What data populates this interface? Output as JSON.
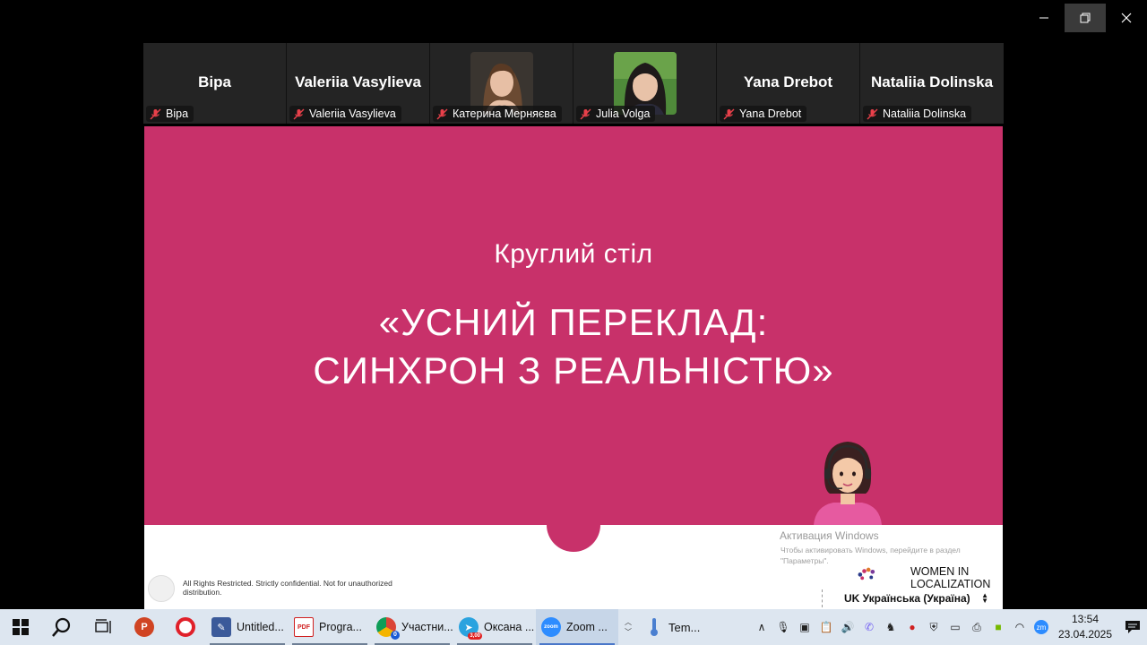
{
  "window": {
    "controls": [
      "minimize",
      "restore",
      "close"
    ]
  },
  "participants": [
    {
      "display": "Віра",
      "tag": "Віра",
      "type": "name"
    },
    {
      "display": "Valeriia Vasylieva",
      "tag": "Valeriia Vasylieva",
      "type": "name"
    },
    {
      "display": "",
      "tag": "Катерина Мерняєва",
      "type": "photo"
    },
    {
      "display": "",
      "tag": "Julia Volga",
      "type": "photo"
    },
    {
      "display": "Yana Drebot",
      "tag": "Yana Drebot",
      "type": "name"
    },
    {
      "display": "Nataliia Dolinska",
      "tag": "Nataliia Dolinska",
      "type": "name"
    }
  ],
  "slide": {
    "subtitle": "Круглий стіл",
    "title_line1": "«УСНИЙ ПЕРЕКЛАД:",
    "title_line2": "СИНХРОН З РЕАЛЬНІСТЮ»",
    "rights_text": "All Rights Restricted. Strictly confidential. Not for unauthorized distribution.",
    "logo_line1": "WOMEN IN",
    "logo_line2": "LOCALIZATION",
    "colors": {
      "accent": "#c8316a"
    }
  },
  "overlay": {
    "activation_title": "Активация Windows",
    "activation_text": "Чтобы активировать Windows, перейдите в раздел \"Параметры\".",
    "language": "UK Українська (Україна)"
  },
  "taskbar": {
    "apps": [
      {
        "label": "Untitled...",
        "icon": "paint-icon"
      },
      {
        "label": "Progra...",
        "icon": "pdf-icon"
      },
      {
        "label": "Участни...",
        "icon": "chrome-icon",
        "badge": "0"
      },
      {
        "label": "Оксана ...",
        "icon": "telegram-icon",
        "badge": "3,00"
      },
      {
        "label": "Zoom ...",
        "icon": "zoom-icon"
      }
    ],
    "weather_label": "Tem...",
    "time": "13:54",
    "date": "23.04.2025"
  }
}
